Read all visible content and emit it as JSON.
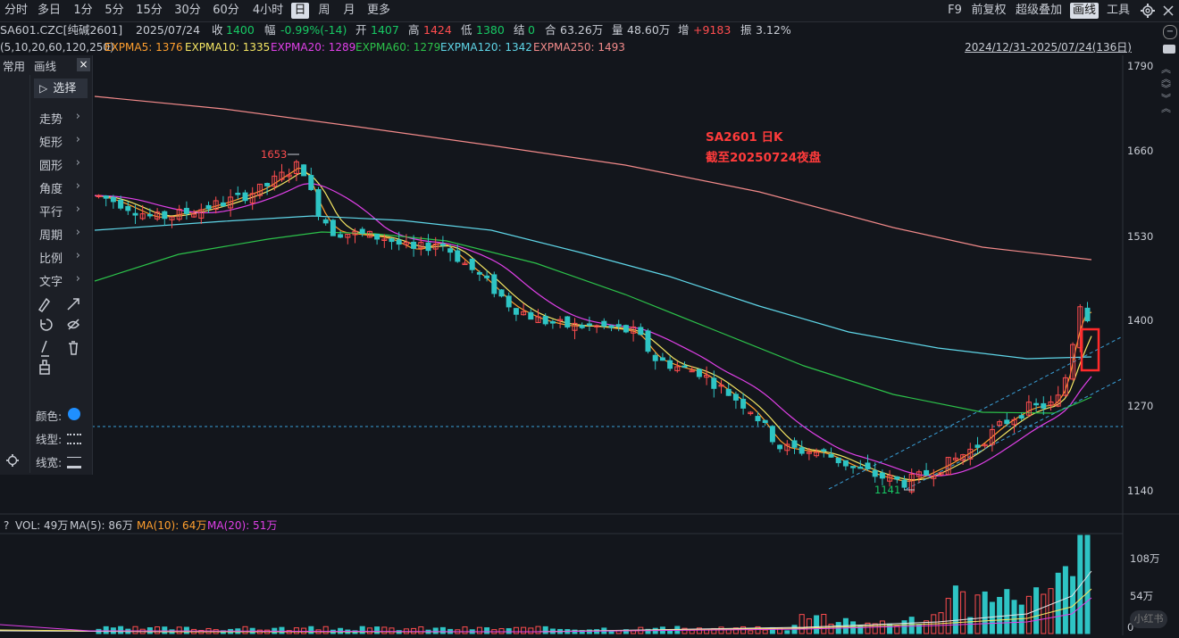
{
  "periods": [
    "分时",
    "多日",
    "1分",
    "5分",
    "15分",
    "30分",
    "60分",
    "4小时",
    "日",
    "周",
    "月",
    "更多"
  ],
  "active_period": "日",
  "right_menu": [
    "F9",
    "前复权",
    "超级叠加",
    "画线",
    "工具"
  ],
  "active_right": "画线",
  "quote": {
    "code": "SA601.CZC[纯碱2601]",
    "date": "2025/07/24",
    "close_label": "收",
    "close": "1400",
    "change_label": "幅",
    "change": "-0.99%(-14)",
    "open_label": "开",
    "open": "1407",
    "high_label": "高",
    "high": "1424",
    "low_label": "低",
    "low": "1380",
    "settle_label": "结",
    "settle": "0",
    "turnover_label": "合",
    "turnover": "63.26万",
    "volume_label": "量",
    "volume": "48.60万",
    "oi_label": "增",
    "oi_change": "+9183",
    "amp_label": "振",
    "amplitude": "3.12%"
  },
  "ma_params": "(5,10,20,60,120,250)",
  "ma_lines": [
    {
      "label": "EXPMA5: 1376",
      "color": "#ff9f2e"
    },
    {
      "label": "EXPMA10: 1335",
      "color": "#f5e663"
    },
    {
      "label": "EXPMA20: 1289",
      "color": "#e040e8"
    },
    {
      "label": "EXPMA60: 1279",
      "color": "#2cc24a"
    },
    {
      "label": "EXPMA120: 1342",
      "color": "#5fd6e8"
    },
    {
      "label": "EXPMA250: 1493",
      "color": "#f28a8a"
    }
  ],
  "date_range": "2024/12/31-2025/07/24(136日)",
  "toolbox": {
    "tab_common": "常用",
    "tab_draw": "画线",
    "close": "×",
    "select": "选择",
    "items": [
      "走势",
      "矩形",
      "圆形",
      "角度",
      "平行",
      "周期",
      "比例",
      "文字"
    ],
    "color_label": "颜色:",
    "linetype_label": "线型:",
    "linewidth_label": "线宽:"
  },
  "price_axis": [
    "1790",
    "1660",
    "1530",
    "1400",
    "1270",
    "1140"
  ],
  "annotations": {
    "title": "SA2601 日K",
    "subtitle": "截至20250724夜盘",
    "high_mark": "1653",
    "low_mark": "1141"
  },
  "volume": {
    "label_vol": "VOL: 49万",
    "label_ma5": "MA(5): 86万",
    "label_ma10": "MA(10): 64万",
    "label_ma20": "MA(20): 51万",
    "axis": [
      "108万",
      "54万",
      "0"
    ],
    "help": "?"
  },
  "watermark": "小红书",
  "colors": {
    "up": "#ff4d4f",
    "down": "#2ec4c4",
    "bg": "#13161c"
  }
}
